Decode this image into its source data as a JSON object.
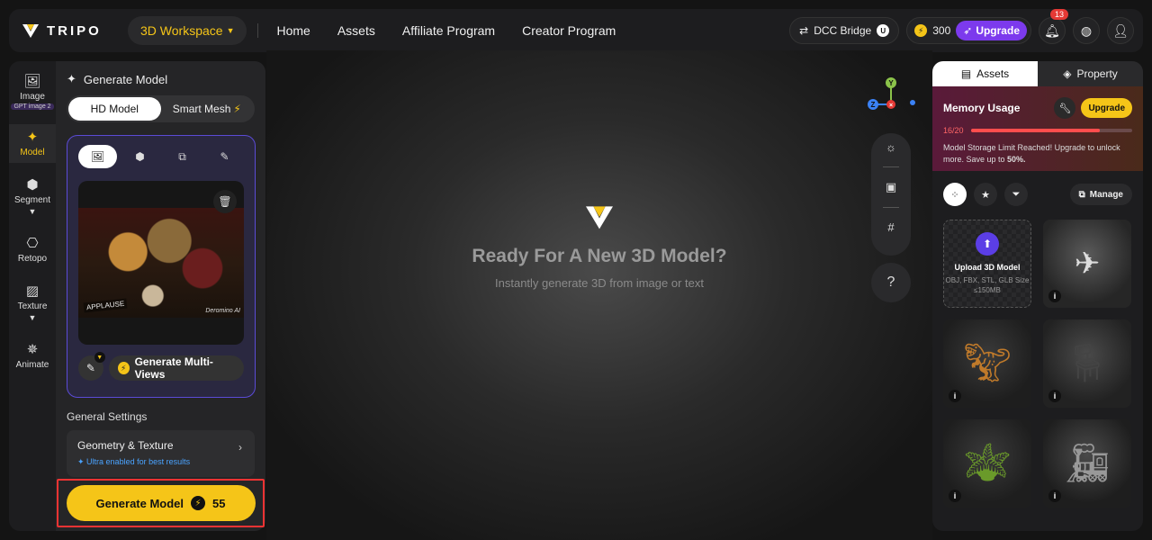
{
  "topbar": {
    "logo_text": "TRIPO",
    "workspace_label": "3D Workspace",
    "nav": [
      "Home",
      "Assets",
      "Affiliate Program",
      "Creator Program"
    ],
    "dcc_label": "DCC Bridge",
    "credits": "300",
    "upgrade_label": "Upgrade",
    "notification_count": "13"
  },
  "rail": {
    "items": [
      {
        "label": "Image",
        "tag": "GPT image 2"
      },
      {
        "label": "Model"
      },
      {
        "label": "Segment"
      },
      {
        "label": "Retopo"
      },
      {
        "label": "Texture"
      },
      {
        "label": "Animate"
      }
    ]
  },
  "panel": {
    "title": "Generate Model",
    "toggle": [
      "HD Model",
      "Smart Mesh"
    ],
    "image_text": "APPLAUSE",
    "image_watermark": "Deromino AI",
    "multiview_label": "Generate Multi-Views",
    "general_settings": "General Settings",
    "gs_main": "Geometry & Texture",
    "gs_sub": "Ultra enabled for best results",
    "generate_label": "Generate Model",
    "generate_cost": "55"
  },
  "viewport": {
    "title": "Ready For A New 3D Model?",
    "subtitle": "Instantly generate 3D from image or text",
    "gizmo": {
      "y": "Y",
      "z": "Z"
    }
  },
  "right": {
    "tabs": [
      "Assets",
      "Property"
    ],
    "memory_title": "Memory Usage",
    "memory_upgrade": "Upgrade",
    "memory_count": "16/20",
    "memory_fraction": 0.8,
    "memory_note_prefix": "Model Storage Limit Reached! Upgrade to unlock more. Save up to ",
    "memory_note_bold": "50%.",
    "manage_label": "Manage",
    "upload_title": "Upload 3D Model",
    "upload_sub": "OBJ, FBX, STL, GLB Size ≤150MB",
    "info_glyph": "i"
  },
  "colors": {
    "accent": "#f5c518",
    "purple": "#7c3aed",
    "danger": "#e33"
  }
}
